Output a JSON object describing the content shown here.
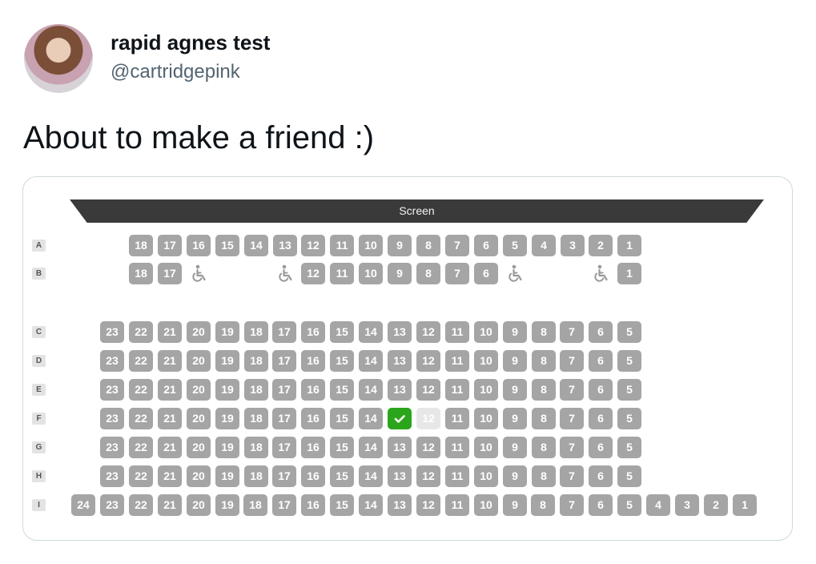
{
  "tweet": {
    "display_name": "rapid agnes test",
    "handle": "@cartridgepink",
    "text": "About to make a friend :)"
  },
  "seat_map": {
    "screen_label": "Screen",
    "colors": {
      "available": "#a5a5a5",
      "selected": "#2ba51c",
      "reserved": "#e7e7e7",
      "screen": "#3a3a3a"
    },
    "rows": [
      {
        "label": "A",
        "seats": [
          "18",
          "17",
          "16",
          "15",
          "14",
          "13",
          "12",
          "11",
          "10",
          "9",
          "8",
          "7",
          "6",
          "5",
          "4",
          "3",
          "2",
          "1"
        ]
      },
      {
        "label": "B",
        "seats": [
          "18",
          "17",
          "wheelchair",
          "wheelchair",
          "12",
          "11",
          "10",
          "9",
          "8",
          "7",
          "6",
          "wheelchair",
          "wheelchair",
          "1"
        ]
      },
      {
        "label": "C",
        "seats": [
          "23",
          "22",
          "21",
          "20",
          "19",
          "18",
          "17",
          "16",
          "15",
          "14",
          "13",
          "12",
          "11",
          "10",
          "9",
          "8",
          "7",
          "6",
          "5"
        ]
      },
      {
        "label": "D",
        "seats": [
          "23",
          "22",
          "21",
          "20",
          "19",
          "18",
          "17",
          "16",
          "15",
          "14",
          "13",
          "12",
          "11",
          "10",
          "9",
          "8",
          "7",
          "6",
          "5"
        ]
      },
      {
        "label": "E",
        "seats": [
          "23",
          "22",
          "21",
          "20",
          "19",
          "18",
          "17",
          "16",
          "15",
          "14",
          "13",
          "12",
          "11",
          "10",
          "9",
          "8",
          "7",
          "6",
          "5"
        ]
      },
      {
        "label": "F",
        "seats": [
          "23",
          "22",
          "21",
          "20",
          "19",
          "18",
          "17",
          "16",
          "15",
          "14",
          "13",
          "12",
          "11",
          "10",
          "9",
          "8",
          "7",
          "6",
          "5"
        ],
        "selected": "13",
        "reserved": [
          "12"
        ]
      },
      {
        "label": "G",
        "seats": [
          "23",
          "22",
          "21",
          "20",
          "19",
          "18",
          "17",
          "16",
          "15",
          "14",
          "13",
          "12",
          "11",
          "10",
          "9",
          "8",
          "7",
          "6",
          "5"
        ]
      },
      {
        "label": "H",
        "seats": [
          "23",
          "22",
          "21",
          "20",
          "19",
          "18",
          "17",
          "16",
          "15",
          "14",
          "13",
          "12",
          "11",
          "10",
          "9",
          "8",
          "7",
          "6",
          "5"
        ]
      },
      {
        "label": "I",
        "seats": [
          "24",
          "23",
          "22",
          "21",
          "20",
          "19",
          "18",
          "17",
          "16",
          "15",
          "14",
          "13",
          "12",
          "11",
          "10",
          "9",
          "8",
          "7",
          "6",
          "5",
          "4",
          "3",
          "2",
          "1"
        ]
      }
    ]
  }
}
